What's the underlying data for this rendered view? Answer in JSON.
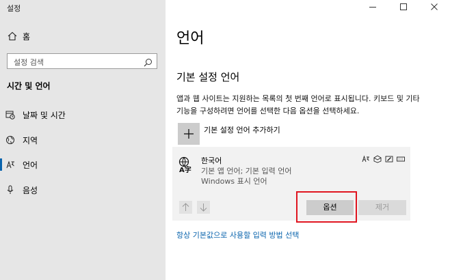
{
  "app": {
    "title": "설정"
  },
  "sidebar": {
    "home_label": "홈",
    "search_placeholder": "설정 검색",
    "section_title": "시간 및 언어",
    "items": [
      {
        "label": "날짜 및 시간",
        "icon": "calendar-clock-icon"
      },
      {
        "label": "지역",
        "icon": "globe-icon"
      },
      {
        "label": "언어",
        "icon": "language-icon",
        "active": true
      },
      {
        "label": "음성",
        "icon": "microphone-icon"
      }
    ]
  },
  "main": {
    "title": "언어",
    "subtitle": "기본 설정 언어",
    "description": "앱과 웹 사이트는 지원하는 목록의 첫 번째 언어로 표시됩니다. 키보드 및 기타 기능을 구성하려면 언어를 선택한 다음 옵션을 선택하세요.",
    "add_language_label": "기본 설정 언어 추가하기",
    "language": {
      "name": "한국어",
      "subtitle1": "기본 앱 언어; 기본 입력 언어",
      "subtitle2": "Windows 표시 언어",
      "options_label": "옵션",
      "remove_label": "제거"
    },
    "link_label": "항상 기본값으로 사용할 입력 방법 선택"
  },
  "colors": {
    "accent": "#0a64ad",
    "highlight": "#e0141f",
    "sidebar_bg": "#e6e6e6"
  }
}
